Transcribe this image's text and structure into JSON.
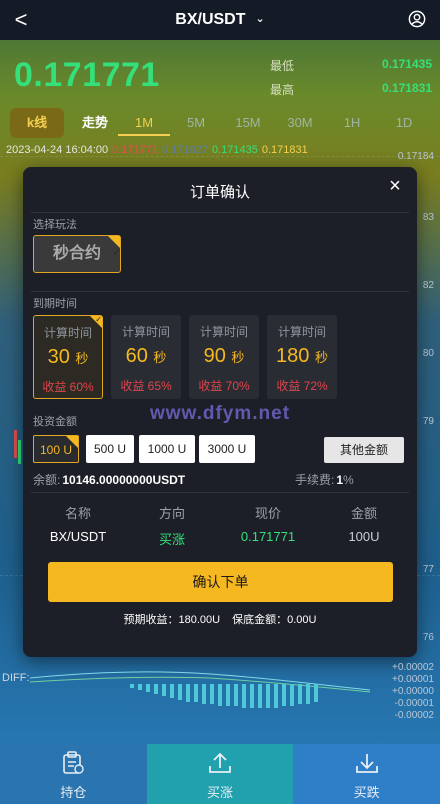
{
  "header": {
    "back": "<",
    "pair": "BX/USDT",
    "chev": "⌄"
  },
  "price": "0.171771",
  "low_label": "最低",
  "low_value": "0.171435",
  "high_label": "最高",
  "high_value": "0.171831",
  "chart_tabs": {
    "kline": "k线",
    "trend": "走势"
  },
  "timeframes": [
    "1M",
    "5M",
    "15M",
    "30M",
    "1H",
    "1D"
  ],
  "ohlc": {
    "datetime": "2023-04-24 16:04:00",
    "open": "0.171771",
    "close": "0.171827",
    "low": "0.171435",
    "high": "0.171831"
  },
  "axis": {
    "top": "0.17184",
    "row2": "83",
    "row3": "82",
    "row4": "80",
    "row5": "79",
    "row6": "77",
    "row7": "76"
  },
  "modal": {
    "title": "订单确认",
    "close": "×",
    "select_mode_label": "选择玩法",
    "mode": "秒合约",
    "expiry_label": "到期时间",
    "time_options": [
      {
        "label": "计算时间",
        "value": "30",
        "unit": "秒",
        "profit": "收益 60%"
      },
      {
        "label": "计算时间",
        "value": "60",
        "unit": "秒",
        "profit": "收益 65%"
      },
      {
        "label": "计算时间",
        "value": "90",
        "unit": "秒",
        "profit": "收益 70%"
      },
      {
        "label": "计算时间",
        "value": "180",
        "unit": "秒",
        "profit": "收益 72%"
      }
    ],
    "watermark": "www.dfym.net",
    "amount_label": "投资金额",
    "amounts": [
      "100 U",
      "500 U",
      "1000 U",
      "3000 U"
    ],
    "other_amount": "其他金额",
    "balance_label": "余额:",
    "balance_value": "10146.00000000USDT",
    "fee_label": "手续费:",
    "fee_value": "1",
    "fee_unit": "%",
    "table_headers": [
      "名称",
      "方向",
      "现价",
      "金额"
    ],
    "table_row": {
      "name": "BX/USDT",
      "direction": "买涨",
      "price": "0.171771",
      "amount": "100U"
    },
    "confirm": "确认下单",
    "expected_profit": "预期收益：180.00U",
    "margin": "保底金额：0.00U"
  },
  "diff_label": "DIFF:",
  "diff_axis": [
    "+0.00002",
    "+0.00001",
    "+0.00000",
    "-0.00001",
    "-0.00002"
  ],
  "bottom_tabs": {
    "hold": "持仓",
    "up": "买涨",
    "down": "买跌"
  }
}
